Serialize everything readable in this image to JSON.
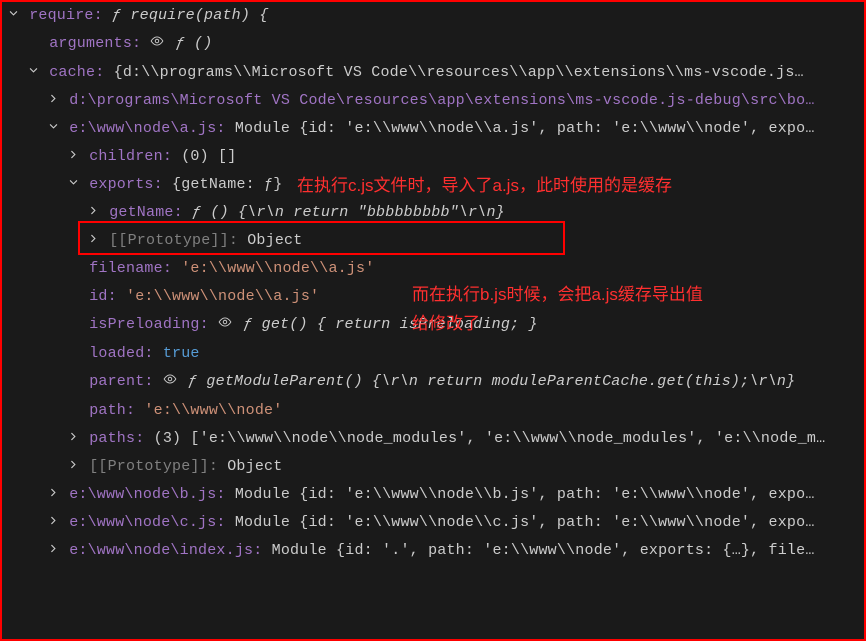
{
  "top": {
    "require_label": "require:",
    "require_val": "ƒ require(path) {",
    "arguments_label": "arguments:",
    "arguments_val": "ƒ ()",
    "cache_label": "cache:",
    "cache_val": "{d:\\\\programs\\\\Microsoft VS Code\\\\resources\\\\app\\\\extensions\\\\ms-vscode.js…"
  },
  "cache_children": {
    "d_label": "d:\\programs\\Microsoft VS Code\\resources\\app\\extensions\\ms-vscode.js-debug\\src\\bo…",
    "e_a_label": "e:\\www\\node\\a.js:",
    "e_a_val": "Module {id: 'e:\\\\www\\\\node\\\\a.js', path: 'e:\\\\www\\\\node', expo…"
  },
  "module_a": {
    "children_label": "children:",
    "children_val": "(0) []",
    "exports_label": "exports:",
    "exports_val": "{getName: ƒ}",
    "getName_label": "getName:",
    "getName_val": "ƒ () {\\r\\n      return \"bbbbbbbbb\"\\r\\n}",
    "proto1_label": "[[Prototype]]:",
    "proto1_val": "Object",
    "filename_label": "filename:",
    "filename_val": "'e:\\\\www\\\\node\\\\a.js'",
    "id_label": "id:",
    "id_val": "'e:\\\\www\\\\node\\\\a.js'",
    "isPreloading_label": "isPreloading:",
    "isPreloading_val": "ƒ get() { return isPreloading; }",
    "loaded_label": "loaded:",
    "loaded_val": "true",
    "parent_label": "parent:",
    "parent_val": "ƒ getModuleParent() {\\r\\n   return moduleParentCache.get(this);\\r\\n}",
    "path_label": "path:",
    "path_val": "'e:\\\\www\\\\node'",
    "paths_label": "paths:",
    "paths_val": "(3) ['e:\\\\www\\\\node\\\\node_modules', 'e:\\\\www\\\\node_modules', 'e:\\\\node_m…",
    "proto2_label": "[[Prototype]]:",
    "proto2_val": "Object"
  },
  "cache_rest": {
    "e_b_label": "e:\\www\\node\\b.js:",
    "e_b_val": "Module {id: 'e:\\\\www\\\\node\\\\b.js', path: 'e:\\\\www\\\\node', expo…",
    "e_c_label": "e:\\www\\node\\c.js:",
    "e_c_val": "Module {id: 'e:\\\\www\\\\node\\\\c.js', path: 'e:\\\\www\\\\node', expo…",
    "e_idx_label": "e:\\www\\node\\index.js:",
    "e_idx_val": "Module {id: '.', path: 'e:\\\\www\\\\node', exports: {…}, file…"
  },
  "annotations": {
    "a1": "在执行c.js文件时，导入了a.js，此时使用的是缓存",
    "a2_line1": "而在执行b.js时候，会把a.js缓存导出值",
    "a2_line2": "给修改了"
  }
}
